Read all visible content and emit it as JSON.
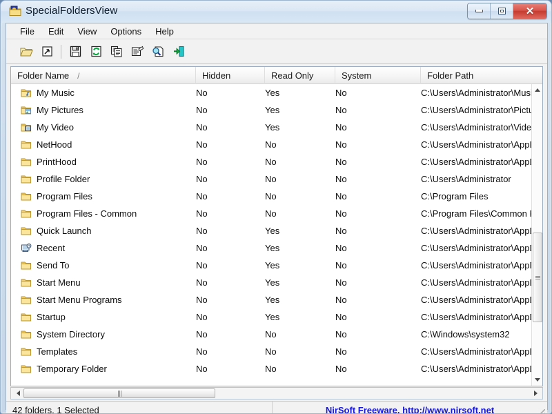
{
  "window": {
    "title": "SpecialFoldersView",
    "icon": "special-folder-icon",
    "controls": {
      "minimize": "–",
      "maximize": "□",
      "close": "✕"
    }
  },
  "menubar": {
    "items": [
      {
        "label": "File"
      },
      {
        "label": "Edit"
      },
      {
        "label": "View"
      },
      {
        "label": "Options"
      },
      {
        "label": "Help"
      }
    ]
  },
  "toolbar": {
    "buttons": [
      {
        "name": "open-folder-icon",
        "tip": "Open Folder"
      },
      {
        "name": "run-shortcut-icon",
        "tip": "Open Shortcut"
      },
      {
        "name": "separator",
        "tip": ""
      },
      {
        "name": "save-icon",
        "tip": "Save Selected Items"
      },
      {
        "name": "refresh-icon",
        "tip": "Refresh"
      },
      {
        "name": "copy-icon",
        "tip": "Copy Selected Items"
      },
      {
        "name": "properties-icon",
        "tip": "Properties"
      },
      {
        "name": "html-report-icon",
        "tip": "HTML Report"
      },
      {
        "name": "exit-icon",
        "tip": "Exit"
      }
    ]
  },
  "listview": {
    "sort_indicator": "/",
    "columns": [
      {
        "key": "name",
        "label": "Folder Name",
        "sorted": true
      },
      {
        "key": "hidden",
        "label": "Hidden"
      },
      {
        "key": "readonly",
        "label": "Read Only"
      },
      {
        "key": "system",
        "label": "System"
      },
      {
        "key": "path",
        "label": "Folder Path"
      }
    ],
    "rows": [
      {
        "icon": "music-folder-icon",
        "name": "My Music",
        "hidden": "No",
        "readonly": "Yes",
        "system": "No",
        "path": "C:\\Users\\Administrator\\Music"
      },
      {
        "icon": "pictures-folder-icon",
        "name": "My Pictures",
        "hidden": "No",
        "readonly": "Yes",
        "system": "No",
        "path": "C:\\Users\\Administrator\\Pictur"
      },
      {
        "icon": "video-folder-icon",
        "name": "My Video",
        "hidden": "No",
        "readonly": "Yes",
        "system": "No",
        "path": "C:\\Users\\Administrator\\Videos"
      },
      {
        "icon": "folder-icon",
        "name": "NetHood",
        "hidden": "No",
        "readonly": "No",
        "system": "No",
        "path": "C:\\Users\\Administrator\\AppDa"
      },
      {
        "icon": "folder-icon",
        "name": "PrintHood",
        "hidden": "No",
        "readonly": "No",
        "system": "No",
        "path": "C:\\Users\\Administrator\\AppDa"
      },
      {
        "icon": "folder-icon",
        "name": "Profile Folder",
        "hidden": "No",
        "readonly": "No",
        "system": "No",
        "path": "C:\\Users\\Administrator"
      },
      {
        "icon": "folder-icon",
        "name": "Program Files",
        "hidden": "No",
        "readonly": "No",
        "system": "No",
        "path": "C:\\Program Files"
      },
      {
        "icon": "folder-icon",
        "name": "Program Files - Common",
        "hidden": "No",
        "readonly": "No",
        "system": "No",
        "path": "C:\\Program Files\\Common Fil"
      },
      {
        "icon": "folder-icon",
        "name": "Quick Launch",
        "hidden": "No",
        "readonly": "Yes",
        "system": "No",
        "path": "C:\\Users\\Administrator\\AppDa"
      },
      {
        "icon": "recent-icon",
        "name": "Recent",
        "hidden": "No",
        "readonly": "Yes",
        "system": "No",
        "path": "C:\\Users\\Administrator\\AppDa"
      },
      {
        "icon": "folder-icon",
        "name": "Send To",
        "hidden": "No",
        "readonly": "Yes",
        "system": "No",
        "path": "C:\\Users\\Administrator\\AppDa"
      },
      {
        "icon": "folder-icon",
        "name": "Start Menu",
        "hidden": "No",
        "readonly": "Yes",
        "system": "No",
        "path": "C:\\Users\\Administrator\\AppDa"
      },
      {
        "icon": "folder-icon",
        "name": "Start Menu Programs",
        "hidden": "No",
        "readonly": "Yes",
        "system": "No",
        "path": "C:\\Users\\Administrator\\AppDa"
      },
      {
        "icon": "folder-icon",
        "name": "Startup",
        "hidden": "No",
        "readonly": "Yes",
        "system": "No",
        "path": "C:\\Users\\Administrator\\AppDa"
      },
      {
        "icon": "folder-icon",
        "name": "System Directory",
        "hidden": "No",
        "readonly": "No",
        "system": "No",
        "path": "C:\\Windows\\system32"
      },
      {
        "icon": "folder-icon",
        "name": "Templates",
        "hidden": "No",
        "readonly": "No",
        "system": "No",
        "path": "C:\\Users\\Administrator\\AppDa"
      },
      {
        "icon": "folder-icon",
        "name": "Temporary Folder",
        "hidden": "No",
        "readonly": "No",
        "system": "No",
        "path": "C:\\Users\\Administrator\\AppDa"
      }
    ]
  },
  "statusbar": {
    "count_text": "42 folders, 1 Selected",
    "credit_text": "NirSoft Freeware.  http://www.nirsoft.net",
    "credit_color": "#1616d8"
  }
}
